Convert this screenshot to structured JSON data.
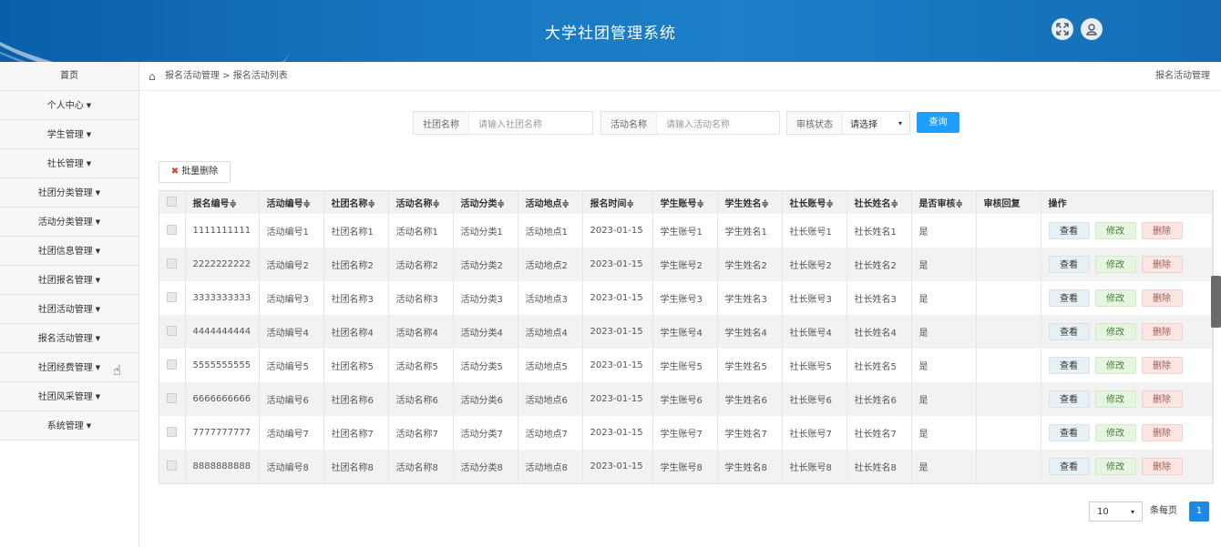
{
  "header": {
    "title": "大学社团管理系统"
  },
  "sidebar": {
    "items": [
      {
        "label": "首页",
        "caret": false
      },
      {
        "label": "个人中心",
        "caret": true
      },
      {
        "label": "学生管理",
        "caret": true
      },
      {
        "label": "社长管理",
        "caret": true
      },
      {
        "label": "社团分类管理",
        "caret": true
      },
      {
        "label": "活动分类管理",
        "caret": true
      },
      {
        "label": "社团信息管理",
        "caret": true
      },
      {
        "label": "社团报名管理",
        "caret": true
      },
      {
        "label": "社团活动管理",
        "caret": true
      },
      {
        "label": "报名活动管理",
        "caret": true
      },
      {
        "label": "社团经费管理",
        "caret": true
      },
      {
        "label": "社团风采管理",
        "caret": true
      },
      {
        "label": "系统管理",
        "caret": true
      }
    ]
  },
  "breadcrumb": {
    "path": "报名活动管理 > 报名活动列表",
    "right": "报名活动管理"
  },
  "search": {
    "club_label": "社团名称",
    "club_placeholder": "请输入社团名称",
    "activity_label": "活动名称",
    "activity_placeholder": "请输入活动名称",
    "status_label": "审核状态",
    "status_value": "请选择",
    "query_label": "查询"
  },
  "batch_delete_label": "批量删除",
  "table": {
    "columns": [
      "报名编号≑",
      "活动编号≑",
      "社团名称≑",
      "活动名称≑",
      "活动分类≑",
      "活动地点≑",
      "报名时间≑",
      "学生账号≑",
      "学生姓名≑",
      "社长账号≑",
      "社长姓名≑",
      "是否审核≑",
      "审核回复",
      "操作"
    ],
    "rows": [
      [
        "1111111111",
        "活动编号1",
        "社团名称1",
        "活动名称1",
        "活动分类1",
        "活动地点1",
        "2023-01-15",
        "学生账号1",
        "学生姓名1",
        "社长账号1",
        "社长姓名1",
        "是",
        ""
      ],
      [
        "2222222222",
        "活动编号2",
        "社团名称2",
        "活动名称2",
        "活动分类2",
        "活动地点2",
        "2023-01-15",
        "学生账号2",
        "学生姓名2",
        "社长账号2",
        "社长姓名2",
        "是",
        ""
      ],
      [
        "3333333333",
        "活动编号3",
        "社团名称3",
        "活动名称3",
        "活动分类3",
        "活动地点3",
        "2023-01-15",
        "学生账号3",
        "学生姓名3",
        "社长账号3",
        "社长姓名3",
        "是",
        ""
      ],
      [
        "4444444444",
        "活动编号4",
        "社团名称4",
        "活动名称4",
        "活动分类4",
        "活动地点4",
        "2023-01-15",
        "学生账号4",
        "学生姓名4",
        "社长账号4",
        "社长姓名4",
        "是",
        ""
      ],
      [
        "5555555555",
        "活动编号5",
        "社团名称5",
        "活动名称5",
        "活动分类5",
        "活动地点5",
        "2023-01-15",
        "学生账号5",
        "学生姓名5",
        "社长账号5",
        "社长姓名5",
        "是",
        ""
      ],
      [
        "6666666666",
        "活动编号6",
        "社团名称6",
        "活动名称6",
        "活动分类6",
        "活动地点6",
        "2023-01-15",
        "学生账号6",
        "学生姓名6",
        "社长账号6",
        "社长姓名6",
        "是",
        ""
      ],
      [
        "7777777777",
        "活动编号7",
        "社团名称7",
        "活动名称7",
        "活动分类7",
        "活动地点7",
        "2023-01-15",
        "学生账号7",
        "学生姓名7",
        "社长账号7",
        "社长姓名7",
        "是",
        ""
      ],
      [
        "8888888888",
        "活动编号8",
        "社团名称8",
        "活动名称8",
        "活动分类8",
        "活动地点8",
        "2023-01-15",
        "学生账号8",
        "学生姓名8",
        "社长账号8",
        "社长姓名8",
        "是",
        ""
      ]
    ],
    "actions": {
      "view": "查看",
      "edit": "修改",
      "delete": "删除"
    }
  },
  "pagination": {
    "page_size": "10",
    "per_page_label": "条每页",
    "current_page": "1"
  },
  "icons": {
    "expand": "expand-icon",
    "user": "user-icon",
    "home": "home-icon",
    "cursor": "hand-cursor-icon"
  },
  "colors": {
    "header": "#1a78c2",
    "primary_button": "#1e9fff",
    "page_active": "#1e88e5"
  }
}
